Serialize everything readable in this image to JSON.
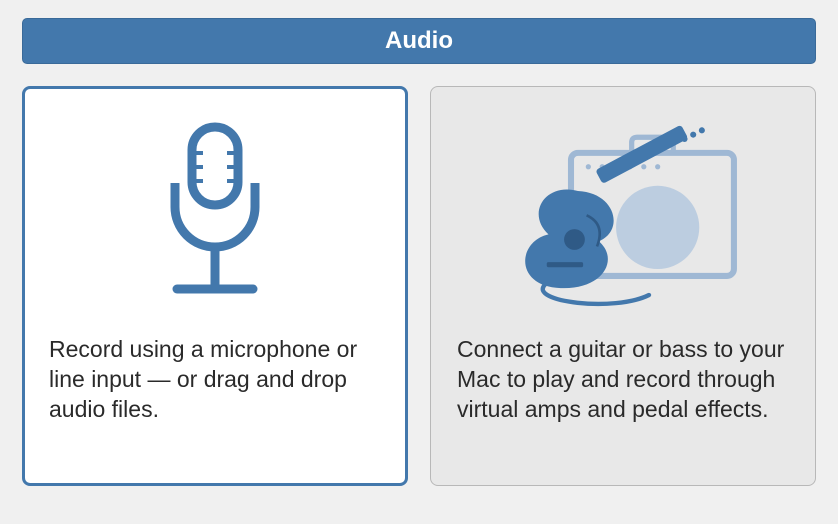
{
  "header": {
    "title": "Audio"
  },
  "options": [
    {
      "icon": "microphone-icon",
      "description": "Record using a microphone or line input — or drag and drop audio files.",
      "selected": true
    },
    {
      "icon": "guitar-amp-icon",
      "description": "Connect a guitar or bass to your Mac to play and record through virtual amps and pedal effects.",
      "selected": false
    }
  ]
}
